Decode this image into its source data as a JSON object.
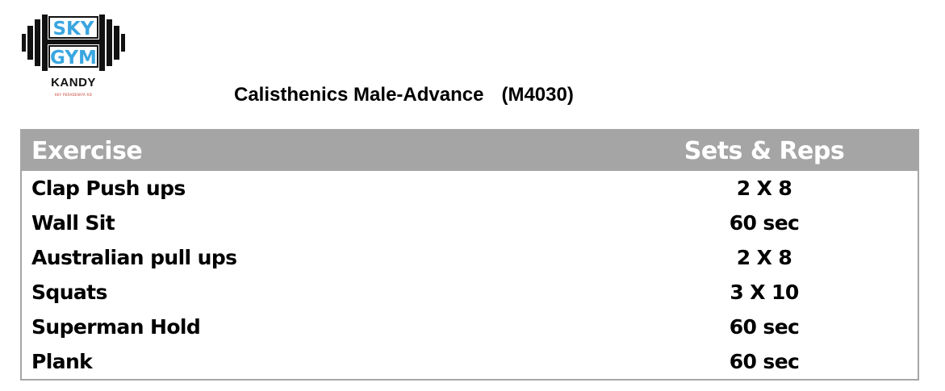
{
  "logo": {
    "line1": "SKY",
    "line2": "GYM",
    "city": "KANDY",
    "small_text": "KKY PERADENIYA RD"
  },
  "title": {
    "name": "Calisthenics Male-Advance",
    "code": "(M4030)"
  },
  "table": {
    "headers": {
      "exercise": "Exercise",
      "sets_reps": "Sets & Reps"
    },
    "rows": [
      {
        "exercise": "Clap Push ups",
        "sets_reps": "2 X 8"
      },
      {
        "exercise": "Wall Sit",
        "sets_reps": "60 sec"
      },
      {
        "exercise": "Australian pull ups",
        "sets_reps": "2 X 8"
      },
      {
        "exercise": "Squats",
        "sets_reps": "3 X 10"
      },
      {
        "exercise": "Superman Hold",
        "sets_reps": "60 sec"
      },
      {
        "exercise": "Plank",
        "sets_reps": "60 sec"
      }
    ]
  },
  "colors": {
    "header_bg": "#a5a5a5",
    "logo_blue": "#3aa6e0",
    "border": "#a6a6a6"
  }
}
